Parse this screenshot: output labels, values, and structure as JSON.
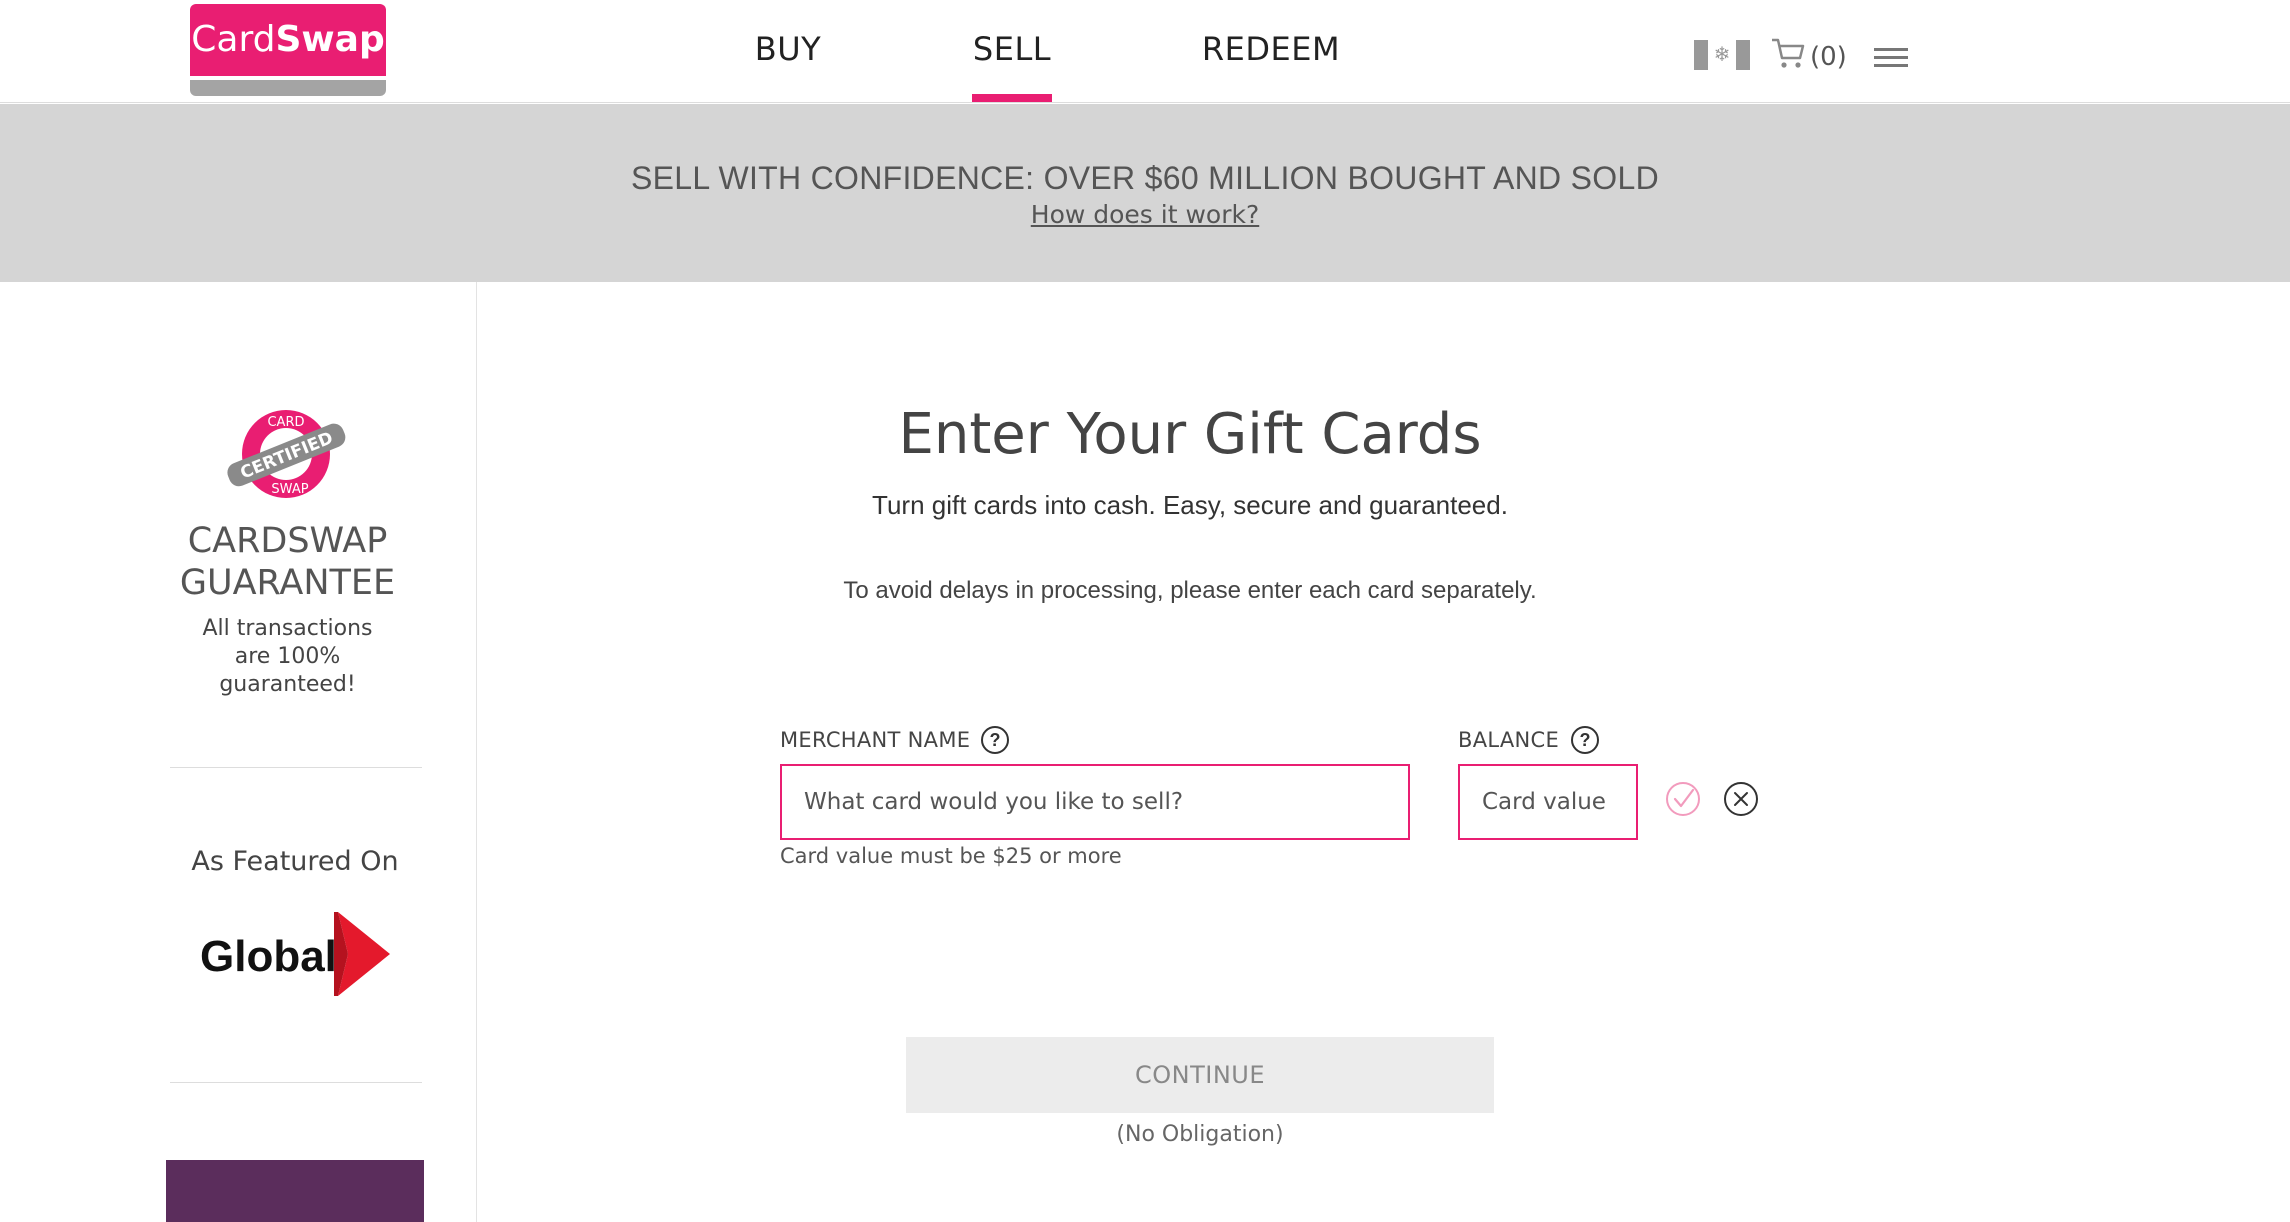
{
  "header": {
    "logo_light": "Card",
    "logo_bold": "Swap",
    "nav": [
      {
        "label": "BUY",
        "active": false
      },
      {
        "label": "SELL",
        "active": true
      },
      {
        "label": "REDEEM",
        "active": false
      }
    ],
    "cart_count": "(0)",
    "flag_icon": "canada-flag-icon",
    "cart_icon": "cart-icon",
    "menu_icon": "hamburger-menu-icon",
    "accent_color": "#e91e72"
  },
  "banner": {
    "title": "SELL WITH CONFIDENCE: OVER $60 MILLION BOUGHT AND SOLD",
    "link": "How does it work?"
  },
  "sidebar": {
    "seal_top": "CARD",
    "seal_middle": "CERTIFIED",
    "seal_bottom": "SWAP",
    "guarantee_title_line1": "CARDSWAP",
    "guarantee_title_line2": "GUARANTEE",
    "guarantee_text": "All transactions are 100% guaranteed!",
    "featured_label": "As Featured On",
    "featured_logo": "Global"
  },
  "main": {
    "title": "Enter Your Gift Cards",
    "subtitle": "Turn gift cards into cash. Easy, secure and guaranteed.",
    "note": "To avoid delays in processing, please enter each card separately.",
    "merchant_label": "MERCHANT NAME",
    "merchant_placeholder": "What card would you like to sell?",
    "balance_label": "BALANCE",
    "balance_placeholder": "Card value",
    "error": "Card value must be $25 or more",
    "continue_label": "CONTINUE",
    "no_obligation": "(No Obligation)"
  }
}
